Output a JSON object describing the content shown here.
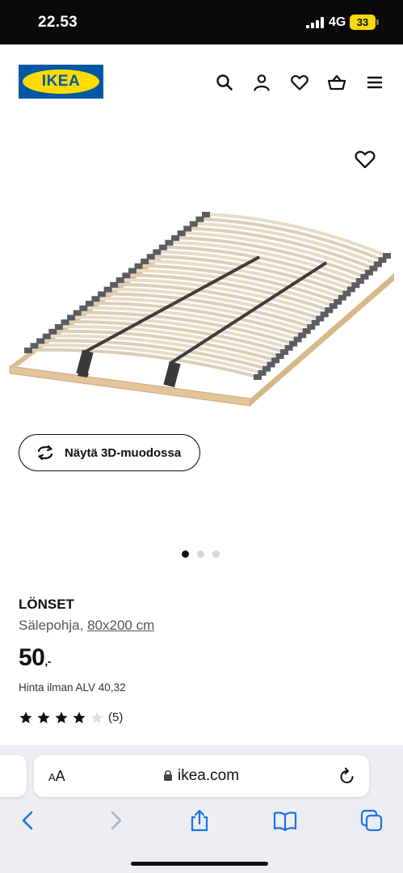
{
  "status_bar": {
    "time": "22.53",
    "network": "4G",
    "battery": "33"
  },
  "header": {
    "logo_text": "IKEA",
    "icons": [
      "search-icon",
      "account-icon",
      "heart-icon",
      "basket-icon",
      "menu-icon"
    ]
  },
  "gallery": {
    "view_3d_label": "Näytä 3D-muodossa",
    "page_count": 3,
    "active_page": 1
  },
  "product": {
    "name": "LÖNSET",
    "type": "Sälepohja,",
    "size": "80x200 cm",
    "price": "50",
    "price_suffix": ",-",
    "vat_note": "Hinta ilman ALV 40,32",
    "rating": 4,
    "rating_max": 5,
    "review_count": "(5)"
  },
  "browser": {
    "aa_label_small": "A",
    "aa_label_large": "A",
    "domain": "ikea.com"
  },
  "colors": {
    "ikea_blue": "#0058a3",
    "ikea_yellow": "#ffdb00",
    "battery": "#f5d90a",
    "ios_blue": "#1a73e8"
  }
}
